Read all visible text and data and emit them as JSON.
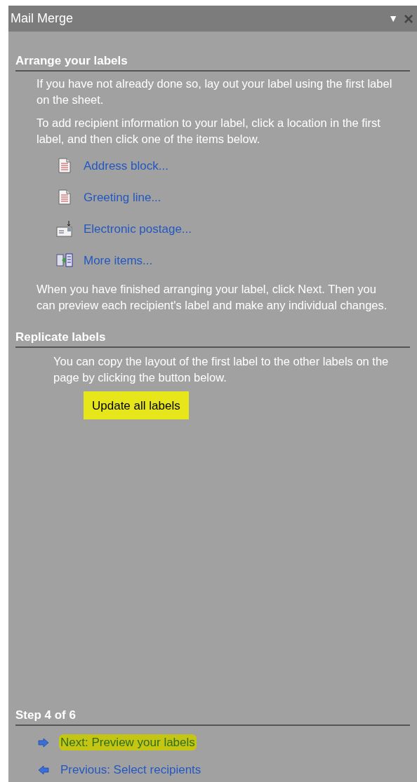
{
  "panel": {
    "title": "Mail Merge",
    "menu_glyph": "▼",
    "close_glyph": "×"
  },
  "arrange": {
    "heading": "Arrange your labels",
    "intro": [
      "If you have not already done so, lay out your label using the first label on the sheet.",
      "To add recipient information to your label, click a location in the first label, and then click one of the items below."
    ],
    "items": [
      {
        "label": "Address block...",
        "kind": "document"
      },
      {
        "label": "Greeting line...",
        "kind": "document"
      },
      {
        "label": "Electronic postage...",
        "kind": "envelope"
      },
      {
        "label": "More items...",
        "kind": "fields"
      }
    ],
    "outro": "When you have finished arranging your label, click Next. Then you can preview each recipient's label and make any individual changes."
  },
  "replicate": {
    "heading": "Replicate labels",
    "text": "You can copy the layout of the first label to the other labels on the page by clicking the button below.",
    "button": {
      "label": "Update all labels",
      "highlighted": true
    }
  },
  "step": {
    "heading": "Step 4 of 6",
    "links": [
      {
        "label": "Next: Preview your labels",
        "kind": "next",
        "highlighted": true
      },
      {
        "label": "Previous: Select recipients",
        "kind": "previous",
        "highlighted": false
      }
    ]
  }
}
